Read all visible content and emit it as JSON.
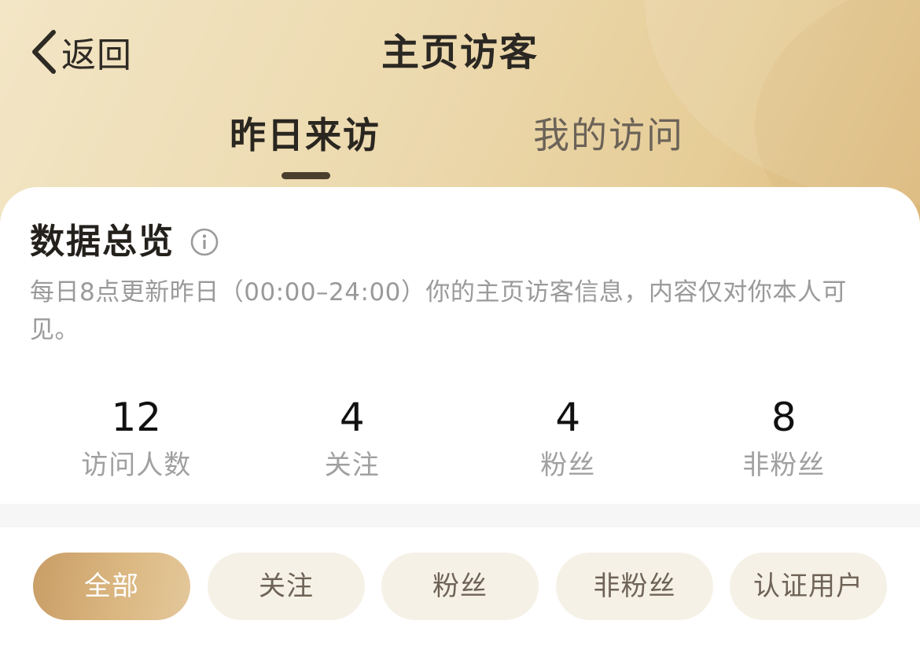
{
  "nav": {
    "back_label": "返回",
    "title": "主页访客"
  },
  "tabs": [
    {
      "label": "昨日来访",
      "active": true
    },
    {
      "label": "我的访问",
      "active": false
    }
  ],
  "overview": {
    "title": "数据总览",
    "info_icon": "info-circle-icon",
    "description": "每日8点更新昨日（00:00–24:00）你的主页访客信息，内容仅对你本人可见。"
  },
  "stats": [
    {
      "value": "12",
      "label": "访问人数"
    },
    {
      "value": "4",
      "label": "关注"
    },
    {
      "value": "4",
      "label": "粉丝"
    },
    {
      "value": "8",
      "label": "非粉丝"
    }
  ],
  "filters": [
    {
      "label": "全部",
      "active": true
    },
    {
      "label": "关注",
      "active": false
    },
    {
      "label": "粉丝",
      "active": false
    },
    {
      "label": "非粉丝",
      "active": false
    },
    {
      "label": "认证用户",
      "active": false
    }
  ],
  "colors": {
    "accent_gold": "#d4ad76",
    "chip_bg": "#f6f1e6",
    "text_dark": "#2b2823",
    "text_muted": "#9a9a9a"
  }
}
